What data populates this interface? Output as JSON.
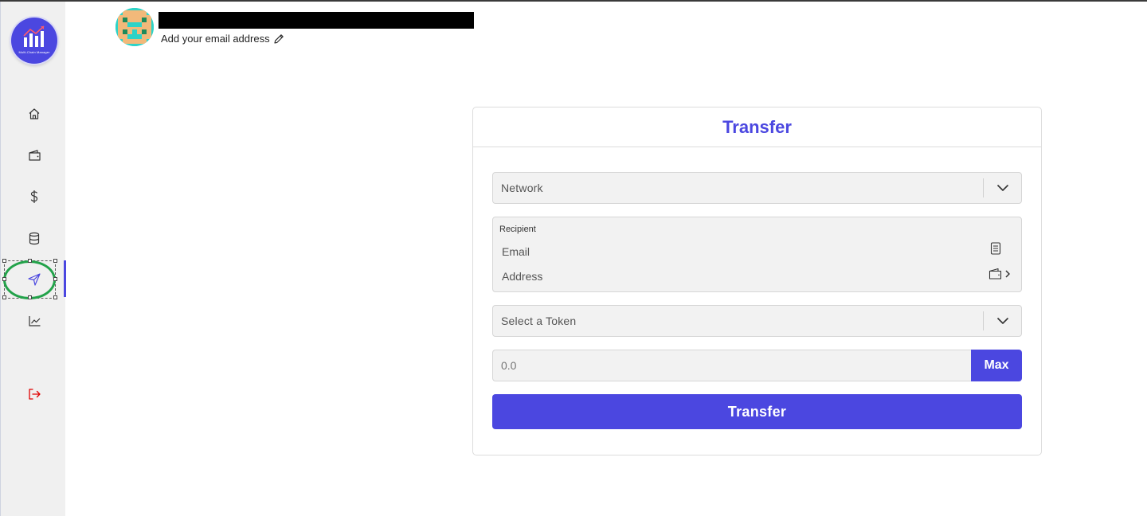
{
  "app": {
    "logo_text": "Multi-Chain Manager",
    "icon": "chart-logo-icon"
  },
  "sidebar": {
    "items": [
      {
        "name": "home",
        "icon": "home-icon"
      },
      {
        "name": "wallet",
        "icon": "wallet-icon"
      },
      {
        "name": "dollar",
        "icon": "dollar-icon"
      },
      {
        "name": "database",
        "icon": "database-icon"
      },
      {
        "name": "send",
        "icon": "send-icon",
        "active": true
      },
      {
        "name": "chart",
        "icon": "chart-line-icon"
      },
      {
        "name": "logout",
        "icon": "logout-icon"
      }
    ],
    "logout_color": "#e00000"
  },
  "profile": {
    "email_prompt": "Add your email address",
    "edit_icon": "pencil-icon"
  },
  "transfer": {
    "title": "Transfer",
    "network_placeholder": "Network",
    "recipient_title": "Recipient",
    "email_label": "Email",
    "address_label": "Address",
    "token_placeholder": "Select a Token",
    "amount_placeholder": "0.0",
    "max_label": "Max",
    "submit_label": "Transfer"
  },
  "colors": {
    "accent": "#4b47e0",
    "field_bg": "#f2f2f2",
    "sidebar_bg": "#f0f0f0",
    "highlight": "#22a24a"
  }
}
